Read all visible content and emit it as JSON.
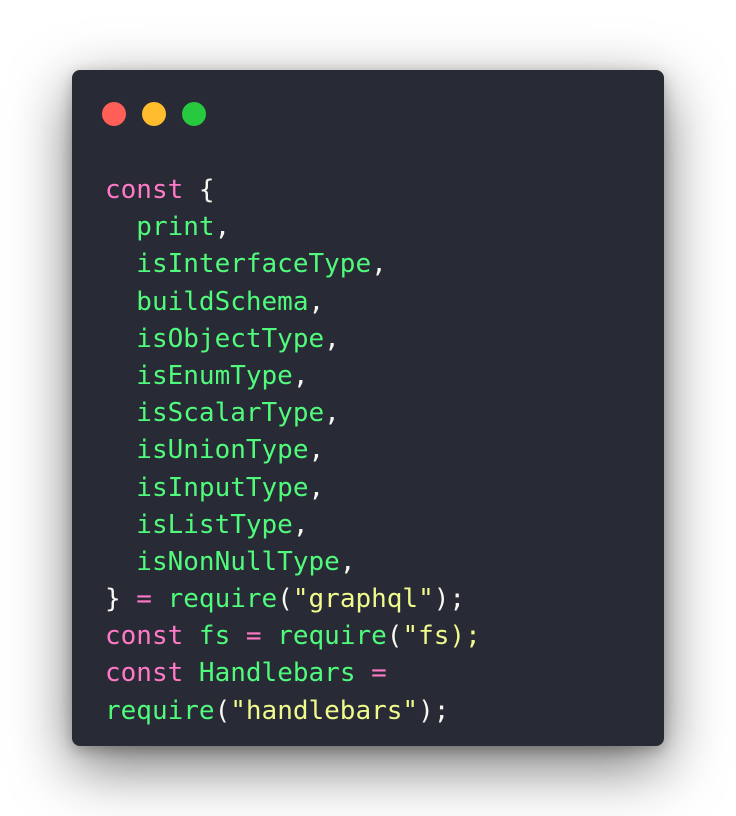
{
  "colors": {
    "background": "#282a36",
    "keyword": "#ff79c6",
    "identifier": "#50fa7b",
    "string": "#f1fa8c",
    "punctuation": "#f8f8f2",
    "close_dot": "#ff5f56",
    "minimize_dot": "#ffbd2e",
    "zoom_dot": "#27c93f"
  },
  "window_controls": [
    "close-dot",
    "minimize-dot",
    "zoom-dot"
  ],
  "code_lines": [
    [
      {
        "t": "const",
        "c": "keyword"
      },
      {
        "t": " {",
        "c": "punctuation"
      }
    ],
    [
      {
        "t": "  print",
        "c": "identifier"
      },
      {
        "t": ",",
        "c": "punctuation"
      }
    ],
    [
      {
        "t": "  isInterfaceType",
        "c": "identifier"
      },
      {
        "t": ",",
        "c": "punctuation"
      }
    ],
    [
      {
        "t": "  buildSchema",
        "c": "identifier"
      },
      {
        "t": ",",
        "c": "punctuation"
      }
    ],
    [
      {
        "t": "  isObjectType",
        "c": "identifier"
      },
      {
        "t": ",",
        "c": "punctuation"
      }
    ],
    [
      {
        "t": "  isEnumType",
        "c": "identifier"
      },
      {
        "t": ",",
        "c": "punctuation"
      }
    ],
    [
      {
        "t": "  isScalarType",
        "c": "identifier"
      },
      {
        "t": ",",
        "c": "punctuation"
      }
    ],
    [
      {
        "t": "  isUnionType",
        "c": "identifier"
      },
      {
        "t": ",",
        "c": "punctuation"
      }
    ],
    [
      {
        "t": "  isInputType",
        "c": "identifier"
      },
      {
        "t": ",",
        "c": "punctuation"
      }
    ],
    [
      {
        "t": "  isListType",
        "c": "identifier"
      },
      {
        "t": ",",
        "c": "punctuation"
      }
    ],
    [
      {
        "t": "  isNonNullType",
        "c": "identifier"
      },
      {
        "t": ",",
        "c": "punctuation"
      }
    ],
    [
      {
        "t": "}",
        "c": "punctuation"
      },
      {
        "t": " = ",
        "c": "keyword"
      },
      {
        "t": "require",
        "c": "identifier"
      },
      {
        "t": "(",
        "c": "punctuation"
      },
      {
        "t": "\"graphql\"",
        "c": "string"
      },
      {
        "t": ");",
        "c": "punctuation"
      }
    ],
    [
      {
        "t": "const",
        "c": "keyword"
      },
      {
        "t": " fs",
        "c": "identifier"
      },
      {
        "t": " = ",
        "c": "keyword"
      },
      {
        "t": "require",
        "c": "identifier"
      },
      {
        "t": "(",
        "c": "punctuation"
      },
      {
        "t": "\"fs);",
        "c": "string"
      }
    ],
    [
      {
        "t": "const",
        "c": "keyword"
      },
      {
        "t": " Handlebars",
        "c": "identifier"
      },
      {
        "t": " =",
        "c": "keyword"
      }
    ],
    [
      {
        "t": "require",
        "c": "identifier"
      },
      {
        "t": "(",
        "c": "punctuation"
      },
      {
        "t": "\"handlebars\"",
        "c": "string"
      },
      {
        "t": ");",
        "c": "punctuation"
      }
    ]
  ]
}
